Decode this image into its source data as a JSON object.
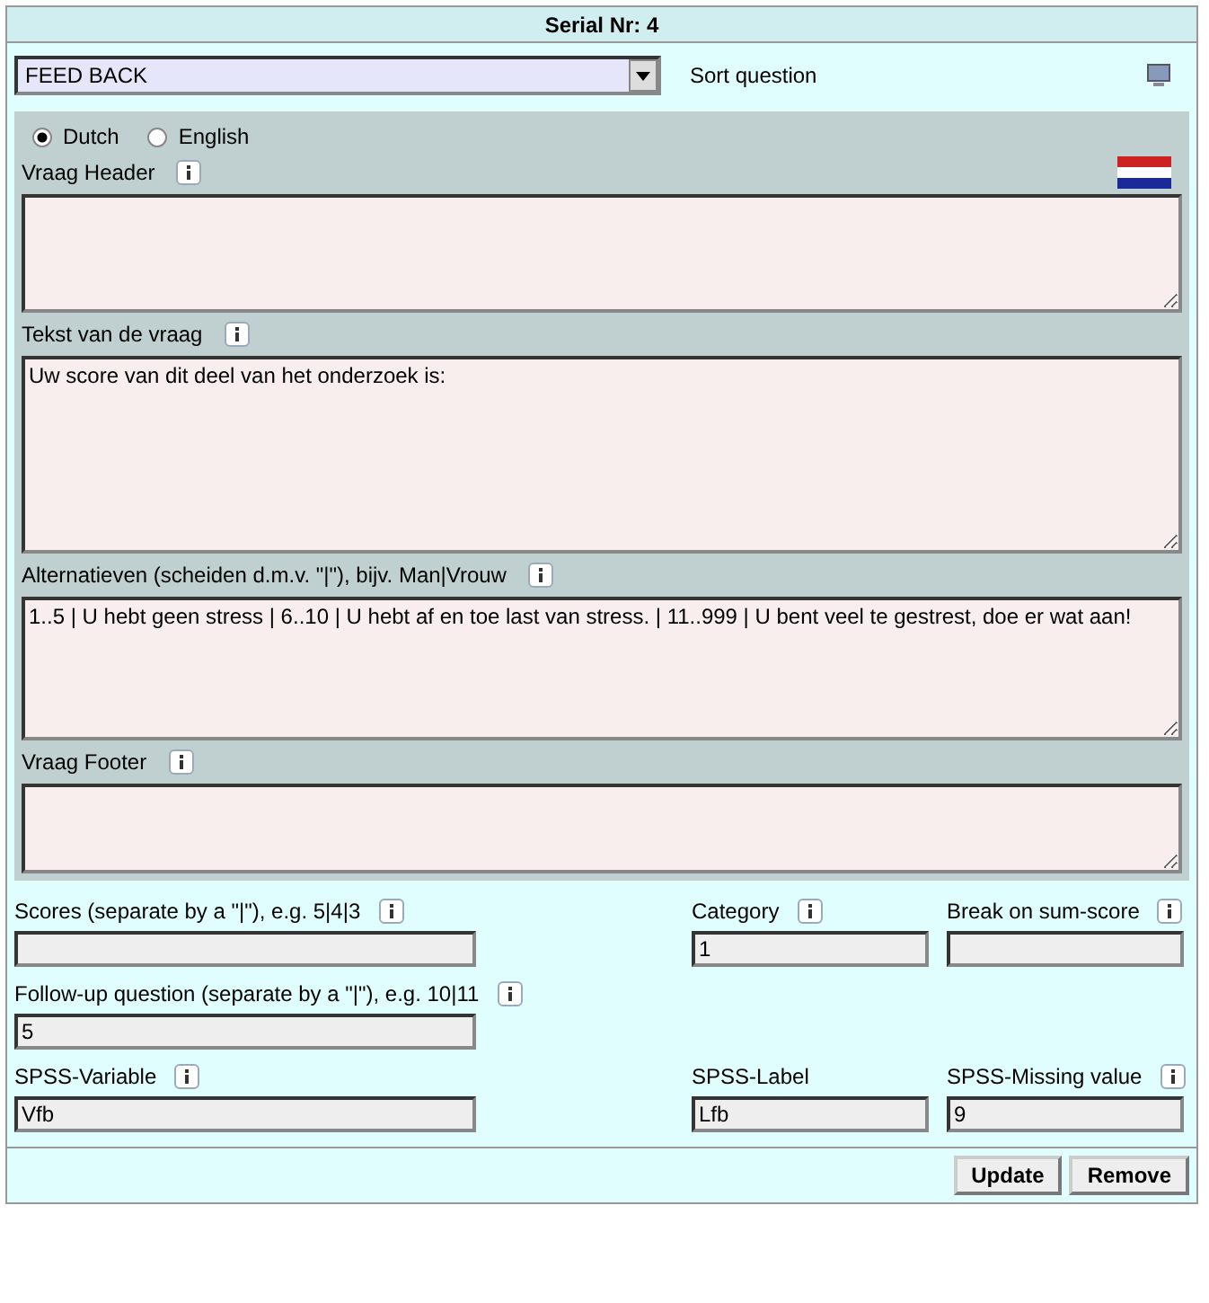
{
  "header": {
    "title": "Serial Nr:  4"
  },
  "question_type": {
    "value": "FEED BACK"
  },
  "sort_label": "Sort question",
  "languages": [
    {
      "label": "Dutch",
      "selected": true
    },
    {
      "label": "English",
      "selected": false
    }
  ],
  "sections": [
    {
      "label": "Vraag Header",
      "info": true,
      "flag": true
    },
    {
      "label": "Tekst van de vraag",
      "info": true,
      "flag": false,
      "value": "Uw score van dit deel van het onderzoek is:"
    },
    {
      "label": "Alternatieven (scheiden d.m.v. \"|\"), bijv. Man|Vrouw",
      "info": true,
      "flag": false,
      "value": "1..5 | U hebt geen stress | 6..10 | U hebt af en toe last van stress. | 11..999 | U bent veel te gestrest, doe er wat aan!"
    },
    {
      "label": "Vraag Footer",
      "info": true,
      "flag": false
    }
  ],
  "field_rows": [
    [
      {
        "label": "Scores (separate by a \"|\"), e.g. 5|4|3",
        "info": true
      },
      {
        "label": "Category",
        "info": true,
        "value": "1"
      },
      {
        "label": "Break on sum-score",
        "info": true
      }
    ],
    [
      {
        "label": "Follow-up question (separate by a \"|\"), e.g. 10|11",
        "info": true,
        "value": "5"
      }
    ],
    [
      {
        "label": "SPSS-Variable",
        "info": true,
        "value": "Vfb"
      },
      {
        "label": "SPSS-Label",
        "info": false,
        "value": "Lfb"
      },
      {
        "label": "SPSS-Missing value",
        "info": true,
        "value": "9"
      }
    ]
  ],
  "buttons": [
    "Update",
    "Remove"
  ]
}
